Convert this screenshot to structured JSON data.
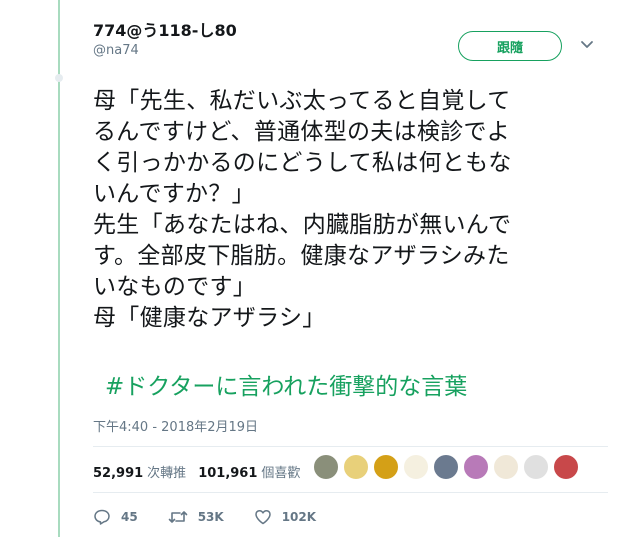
{
  "author": {
    "name": "774@う118-し80",
    "handle": "@na74"
  },
  "follow_label": "跟隨",
  "tweet_lines": [
    "母「先生、私だいぶ太ってると自覚して",
    "るんですけど、普通体型の夫は検診でよ",
    "く引っかかるのにどうして私は何ともな",
    "いんですか？」",
    "先生「あなたはね、内臓脂肪が無いんで",
    "す。全部皮下脂肪。健康なアザラシみた",
    "いなものです」",
    "母「健康なアザラシ」"
  ],
  "hashtag": "#ドクターに言われた衝撃的な言葉",
  "timestamp": "下午4:40 - 2018年2月19日",
  "stats": {
    "retweets_count": "52,991",
    "retweets_label": "次轉推",
    "likes_count": "101,961",
    "likes_label": "個喜歡"
  },
  "liker_colors": [
    "#8a8f7a",
    "#e8d07a",
    "#d4a017",
    "#f5f0e0",
    "#6b7a8f",
    "#b87ab8",
    "#f0e8d8",
    "#e0e0e0",
    "#c8484a"
  ],
  "actions": {
    "replies": "45",
    "retweets": "53K",
    "likes": "102K"
  },
  "colors": {
    "accent": "#17a15f",
    "thread": "#a8dbbf"
  }
}
